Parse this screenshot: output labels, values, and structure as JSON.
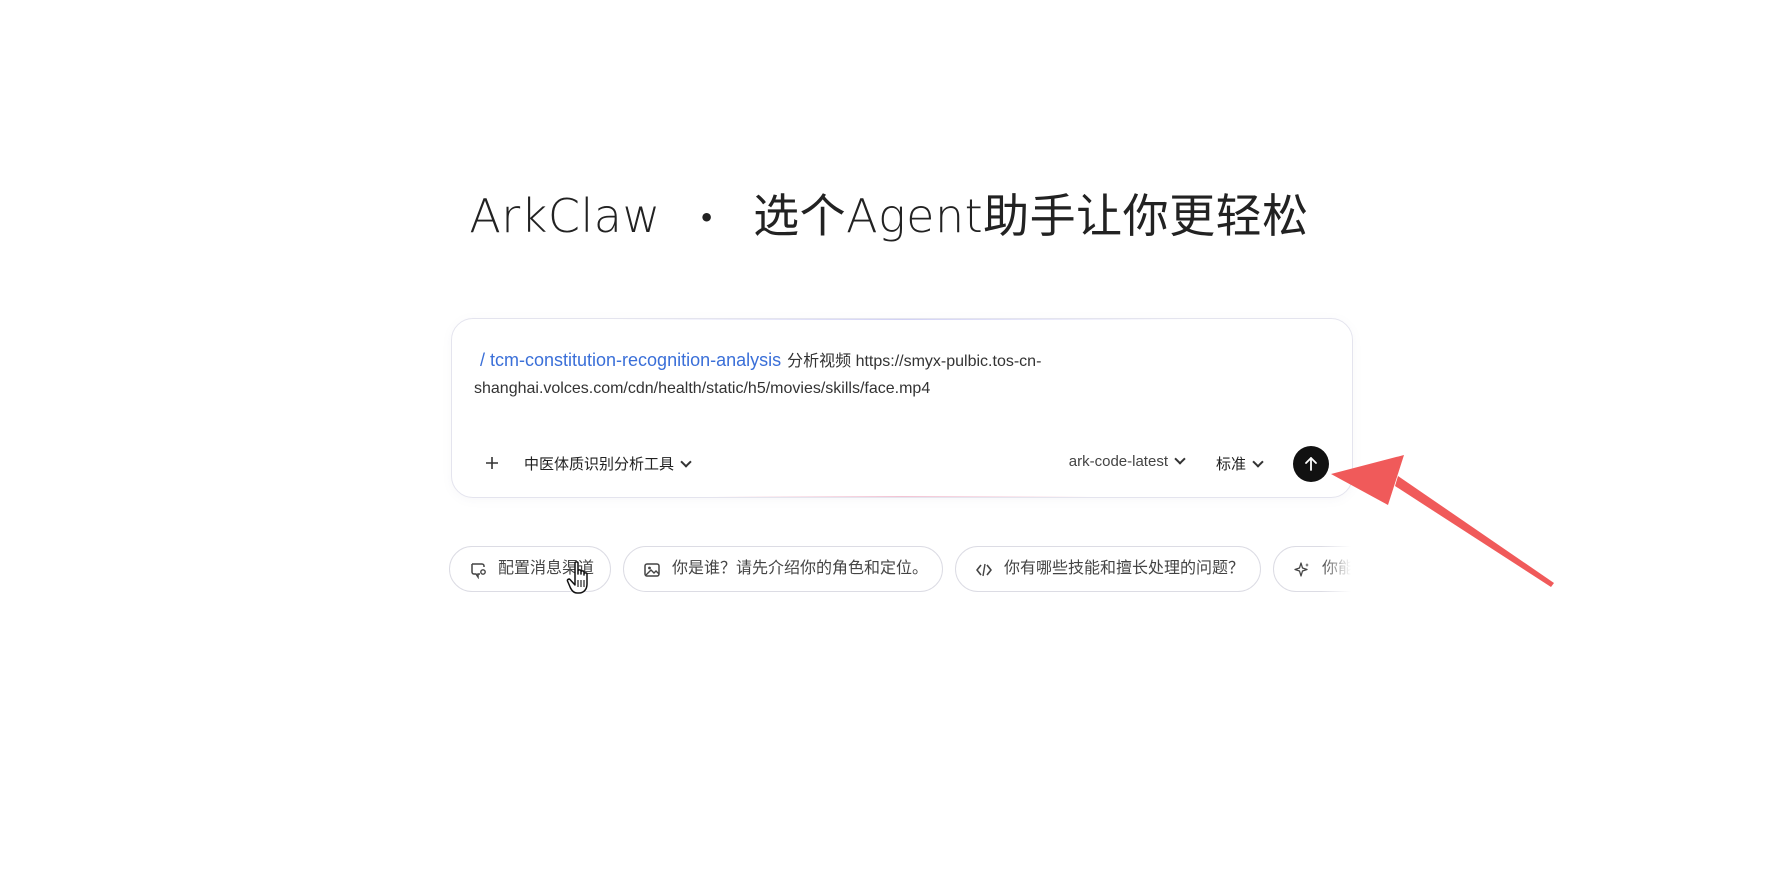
{
  "headline": {
    "brand": "ArkClaw",
    "separator": "・",
    "tagline": "选个Agent助手让你更轻松"
  },
  "composer": {
    "skill_tag": "/ tcm-constitution-recognition-analysis",
    "prompt_text": "分析视频 https://smyx-pulbic.tos-cn-shanghai.volces.com/cdn/health/static/h5/movies/skills/face.mp4",
    "add_icon": "plus-icon",
    "tool_label": "中医体质识别分析工具",
    "model_label": "ark-code-latest",
    "mode_label": "标准",
    "send_icon": "arrow-up-icon"
  },
  "suggestions": [
    {
      "icon": "chat-settings-icon",
      "label": "配置消息渠道"
    },
    {
      "icon": "image-icon",
      "label": "你是谁？请先介绍你的角色和定位。"
    },
    {
      "icon": "code-icon",
      "label": "你有哪些技能和擅长处理的问题？"
    },
    {
      "icon": "sparkle-icon",
      "label": "你能做什么？"
    }
  ],
  "colors": {
    "skill_tag": "#3a6fd8",
    "send_button": "#111111",
    "annotation_arrow": "#f05a5a"
  }
}
